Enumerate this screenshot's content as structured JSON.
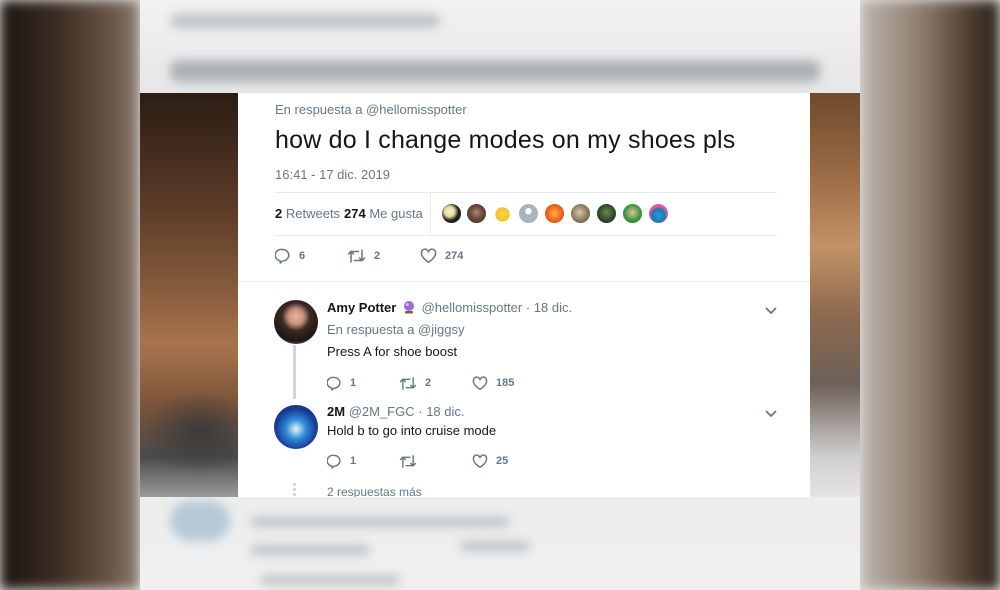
{
  "tweet": {
    "reply_to": "En respuesta a @hellomisspotter",
    "text": "how do I change modes on my shoes pls",
    "timestamp": "16:41 - 17 dic. 2019",
    "retweets_count": "2",
    "retweets_label": "Retweets",
    "likes_count": "274",
    "likes_label": "Me gusta",
    "actions": {
      "replies": "6",
      "retweets": "2",
      "likes": "274"
    }
  },
  "replies": [
    {
      "name": "Amy Potter",
      "handle": "@hellomisspotter",
      "date": "· 18 dic.",
      "reply_to": "En respuesta a @jiggsy",
      "text": "Press A for shoe boost",
      "counts": {
        "replies": "1",
        "retweets": "2",
        "likes": "185"
      }
    },
    {
      "name": "2M",
      "handle": "@2M_FGC",
      "date": "· 18 dic.",
      "text": "Hold b to go into cruise mode",
      "counts": {
        "replies": "1",
        "retweets": "",
        "likes": "25"
      }
    }
  ],
  "more_replies": "2 respuestas más",
  "colors": {
    "muted": "#657786",
    "text": "#14171a",
    "border": "#e6ecf0",
    "emoji_badge": "#8e5bd8"
  },
  "icons": [
    "reply-icon",
    "retweet-icon",
    "heart-icon",
    "chevron-down-icon",
    "crystal-ball-icon"
  ]
}
